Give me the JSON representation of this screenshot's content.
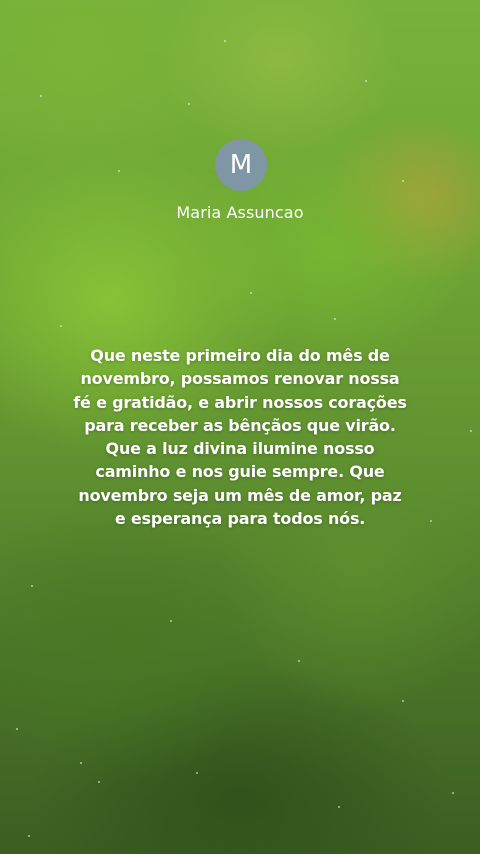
{
  "post": {
    "avatar_letter": "M",
    "author_name": "Maria Assuncao",
    "message": "Que neste primeiro dia do mês de novembro, possamos renovar nossa fé e gratidão, e abrir nossos corações para receber as bênçãos que virão. Que a luz divina ilumine nosso caminho e nos guie sempre. Que novembro seja um mês de amor, paz e esperança para todos nós."
  },
  "colors": {
    "avatar_background": "#7f96a5",
    "text": "#ffffff",
    "background_top": "#78b23a",
    "background_bottom": "#3c5e22"
  }
}
